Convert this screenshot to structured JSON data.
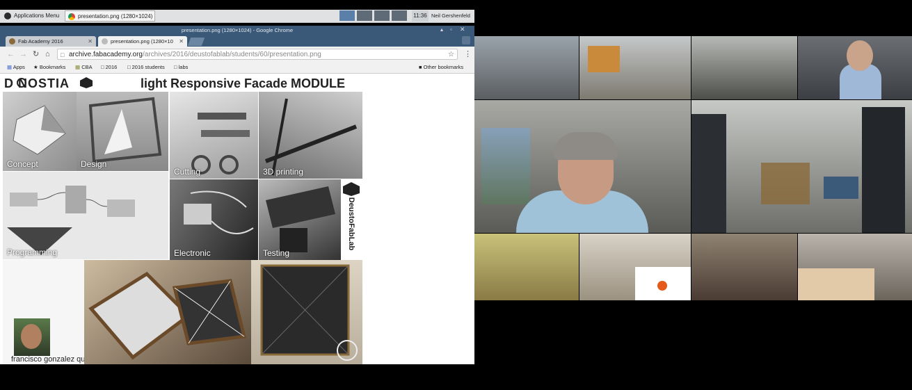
{
  "panel": {
    "apps_menu": "Applications Menu",
    "task": "presentation.png (1280×1024) - ...",
    "clock": "11:36",
    "user": "Neil Gershenfeld"
  },
  "browser": {
    "window_title": "presentation.png (1280×1024) - Google Chrome",
    "tabs": [
      {
        "label": "Fab Academy 2016"
      },
      {
        "label": "presentation.png (1280×10"
      }
    ],
    "url_host": "archive.fabacademy.org",
    "url_path": "/archives/2016/deustofablab/students/60/presentation.png",
    "bookmarks": [
      "Apps",
      "Bookmarks",
      "CBA",
      "2016",
      "2016 students",
      "labs"
    ],
    "other_bookmarks": "Other bookmarks"
  },
  "poster": {
    "title_left": "D  NOSTIA",
    "title_right": "light Responsive Facade MODULE",
    "tiles": [
      "Concept",
      "Design",
      "Cutting",
      "3D printing",
      "Programming",
      "Electronic",
      "Testing"
    ],
    "sponsor": "DeustoFabLab",
    "author": "francisco gonzalez quintial"
  },
  "colors": {
    "titlebar": "#3a5877",
    "panel": "#dfe1e3",
    "background": "#000000"
  }
}
